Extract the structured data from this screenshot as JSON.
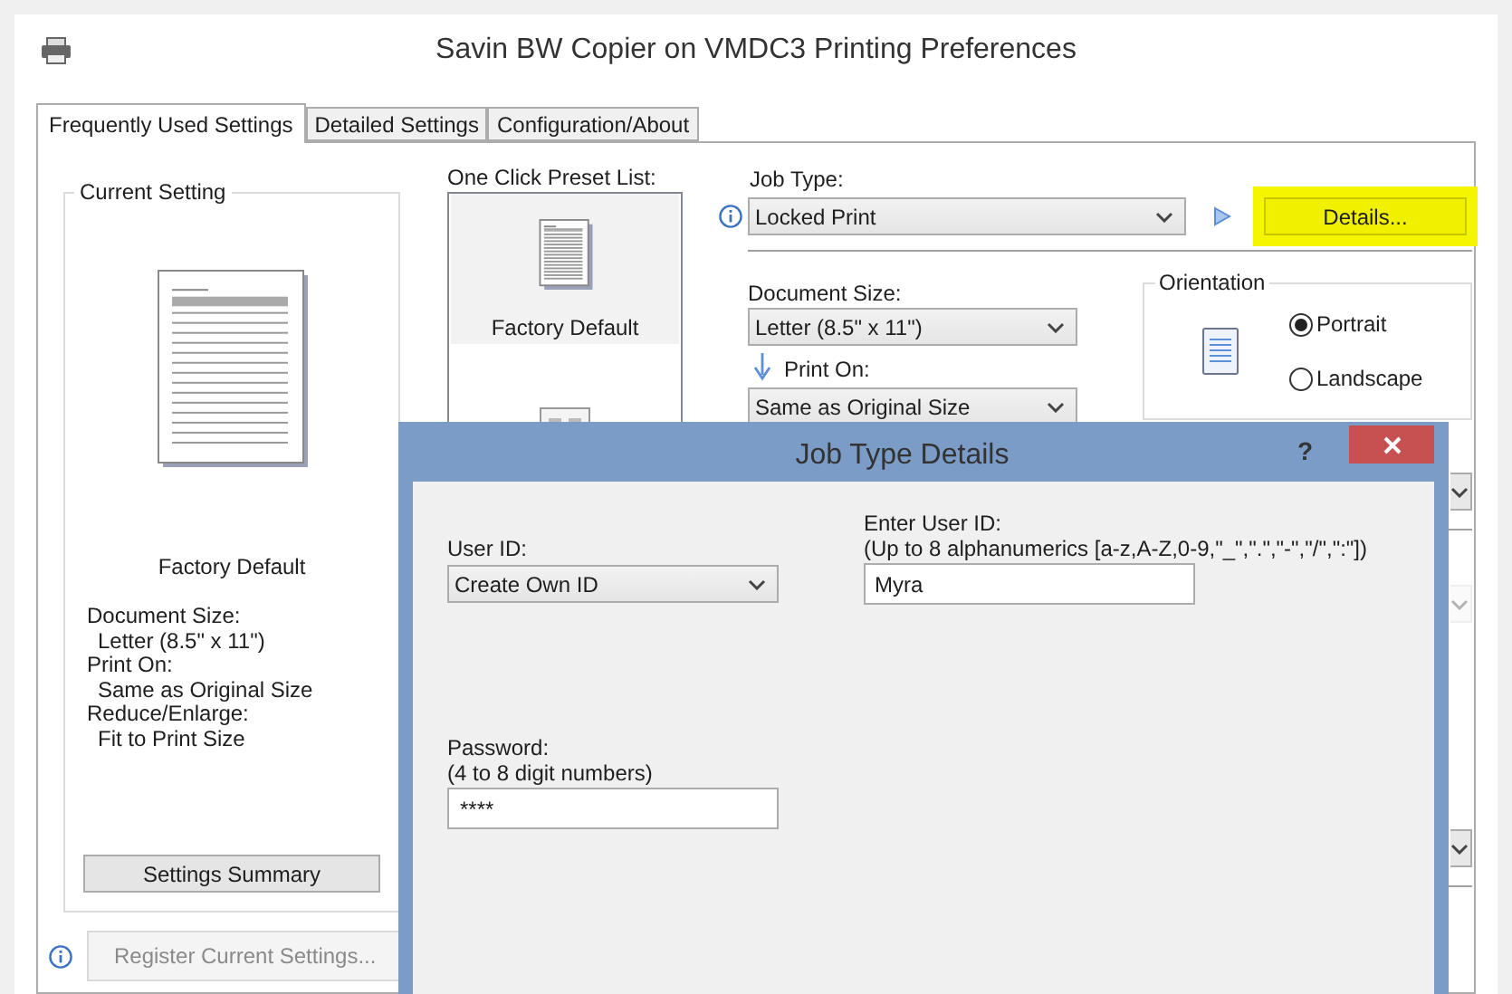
{
  "window": {
    "title": "Savin BW Copier on VMDC3 Printing Preferences"
  },
  "tabs": [
    {
      "label": "Frequently Used Settings",
      "selected": true
    },
    {
      "label": "Detailed Settings",
      "selected": false
    },
    {
      "label": "Configuration/About",
      "selected": false
    }
  ],
  "current_setting": {
    "title": "Current Setting",
    "preset_name": "Factory Default",
    "summary": [
      {
        "label": "Document Size:",
        "value": "Letter (8.5\" x 11\")"
      },
      {
        "label": "Print On:",
        "value": "Same as Original Size"
      },
      {
        "label": "Reduce/Enlarge:",
        "value": "Fit to Print Size"
      }
    ],
    "button": "Settings Summary"
  },
  "preset_list": {
    "label": "One Click Preset List:",
    "items": [
      {
        "kind": "document",
        "name": "Factory Default",
        "selected": true
      },
      {
        "kind": "two-up",
        "selected": false
      }
    ]
  },
  "register_button": {
    "label": "Register Current Settings...",
    "disabled": true
  },
  "job_type": {
    "label": "Job Type:",
    "value": "Locked Print",
    "details_button": "Details...",
    "highlighted": true
  },
  "document_size": {
    "label": "Document Size:",
    "value": "Letter (8.5\" x 11\")"
  },
  "print_on": {
    "label": "Print On:",
    "value": "Same as Original Size"
  },
  "orientation": {
    "title": "Orientation",
    "options": [
      {
        "label": "Portrait",
        "selected": true
      },
      {
        "label": "Landscape",
        "selected": false
      }
    ]
  },
  "hidden_dropdowns": [
    {
      "disabled": false
    },
    {
      "disabled": true
    },
    {
      "disabled": false
    }
  ],
  "dialog": {
    "title": "Job Type Details",
    "help": "?",
    "user_id": {
      "label": "User ID:",
      "value": "Create Own ID"
    },
    "enter_user_id": {
      "label": "Enter User ID:",
      "hint": "(Up to 8 alphanumerics [a-z,A-Z,0-9,\"_\",\".\",\"-\",\"/\",\":\"])",
      "value": "Myra"
    },
    "password": {
      "label": "Password:",
      "hint": "(4 to 8 digit numbers)",
      "value": "****"
    }
  }
}
